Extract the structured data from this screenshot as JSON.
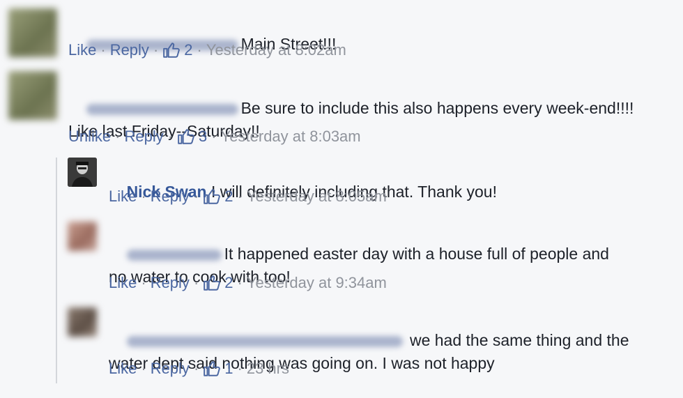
{
  "comments": [
    {
      "text": "Main Street!!!",
      "actions": {
        "primary": "Like",
        "reply": "Reply",
        "likes": "2",
        "time": "Yesterday at 8:02am"
      }
    },
    {
      "text": "Be sure to include this also happens every week-end!!!!\nLike last Friday--Saturday!!",
      "actions": {
        "primary": "Unlike",
        "reply": "Reply",
        "likes": "3",
        "time": "Yesterday at 8:03am"
      }
    },
    {
      "author": "Nick Swan",
      "text": " I will definitely including that. Thank you!",
      "actions": {
        "primary": "Like",
        "reply": "Reply",
        "likes": "2",
        "time": "Yesterday at 8:05am"
      }
    },
    {
      "text": "It happened easter day with a house full of people and\nno water to cook with too!",
      "actions": {
        "primary": "Like",
        "reply": "Reply",
        "likes": "2",
        "time": "Yesterday at 9:34am"
      }
    },
    {
      "text": " we had the same thing and the\nwater dept said nothing was going on. I was not happy",
      "actions": {
        "primary": "Like",
        "reply": "Reply",
        "likes": "1",
        "time": "23 hrs"
      }
    }
  ],
  "colors": {
    "link": "#4b67a1",
    "author": "#365899",
    "meta": "#90949c",
    "background": "#f6f7f9"
  },
  "icons": {
    "like": "thumbs-up-icon"
  }
}
